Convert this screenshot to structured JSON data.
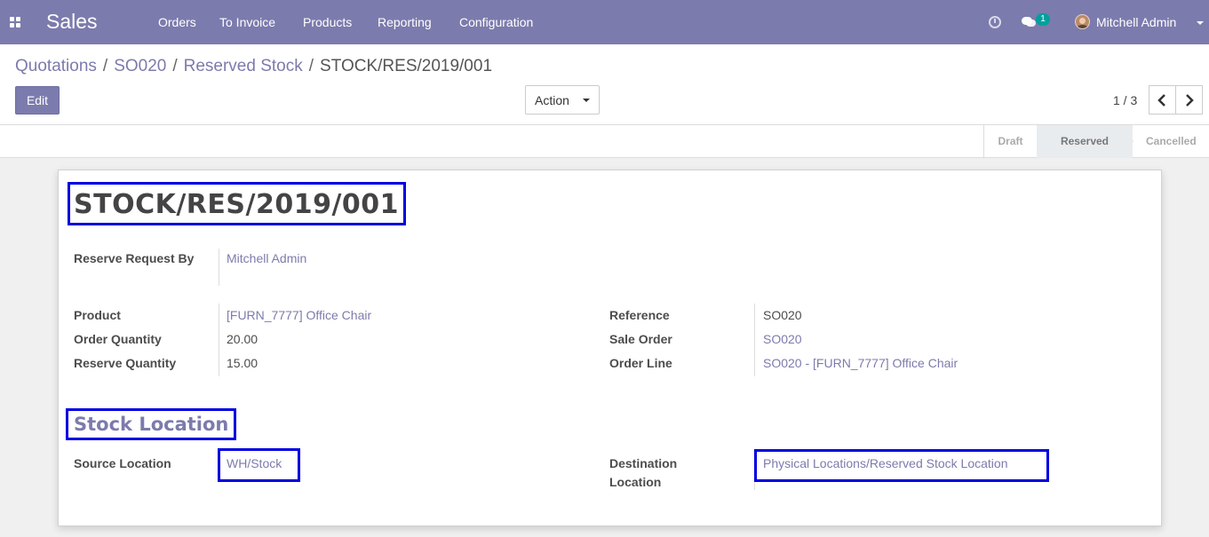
{
  "navbar": {
    "app_name": "Sales",
    "menu": [
      "Orders",
      "To Invoice",
      "Products",
      "Reporting",
      "Configuration"
    ],
    "chat_count": "1",
    "user_name": "Mitchell Admin",
    "icons": [
      "apps-icon",
      "clock-icon",
      "chat-icon",
      "avatar"
    ]
  },
  "breadcrumb": {
    "items": [
      "Quotations",
      "SO020",
      "Reserved Stock"
    ],
    "separator": "/",
    "current": "STOCK/RES/2019/001"
  },
  "buttons": {
    "edit": "Edit",
    "action": "Action"
  },
  "pager": {
    "text": "1 / 3"
  },
  "status": {
    "stages": [
      "Draft",
      "Reserved",
      "Cancelled"
    ],
    "active": "Reserved"
  },
  "record": {
    "title": "STOCK/RES/2019/001",
    "reserve_request_by_label": "Reserve Request By",
    "reserve_request_by": "Mitchell Admin",
    "product_label": "Product",
    "product": "[FURN_7777] Office Chair",
    "order_qty_label": "Order Quantity",
    "order_qty": "20.00",
    "reserve_qty_label": "Reserve Quantity",
    "reserve_qty": "15.00",
    "reference_label": "Reference",
    "reference": "SO020",
    "sale_order_label": "Sale Order",
    "sale_order": "SO020",
    "order_line_label": "Order Line",
    "order_line": "SO020 - [FURN_7777] Office Chair",
    "section_title": "Stock Location",
    "source_location_label": "Source Location",
    "source_location": "WH/Stock",
    "dest_location_label": "Destination Location",
    "dest_location": "Physical Locations/Reserved Stock Location"
  },
  "colors": {
    "brand": "#7c7bad",
    "badge": "#00a09d",
    "highlight": "#0000e0"
  }
}
